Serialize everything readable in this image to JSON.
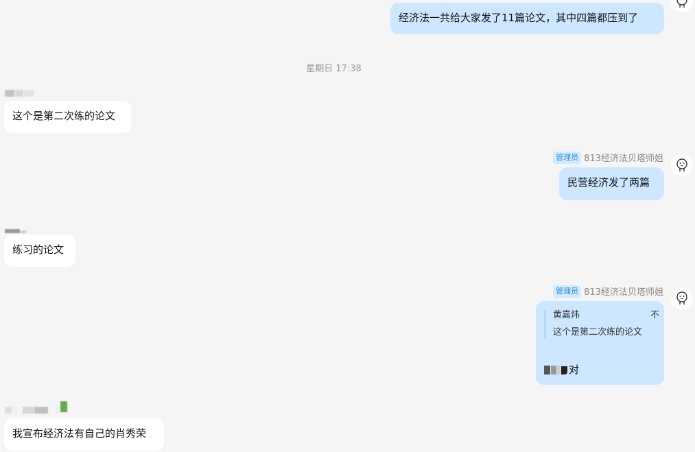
{
  "messages": {
    "m1": {
      "text": "经济法一共给大家发了11篇论文，其中四篇都压到了"
    },
    "timestamp": "星期日 17:38",
    "m2": {
      "text": "这个是第二次练的论文"
    },
    "m3": {
      "badge": "管理员",
      "sender": "813经济法贝塔师姐",
      "text": "民营经济发了两篇"
    },
    "m4": {
      "text": "练习的论文"
    },
    "m5": {
      "badge": "管理员",
      "sender": "813经济法贝塔师姐",
      "quote_author": "黄嘉炜",
      "quote_suffix": "不",
      "quote_text": "这个是第二次练的论文",
      "reply_text": "对"
    },
    "m6": {
      "text": "我宣布经济法有自己的肖秀荣"
    }
  },
  "icons": {
    "avatar": "cartoon-face-avatar-icon"
  }
}
